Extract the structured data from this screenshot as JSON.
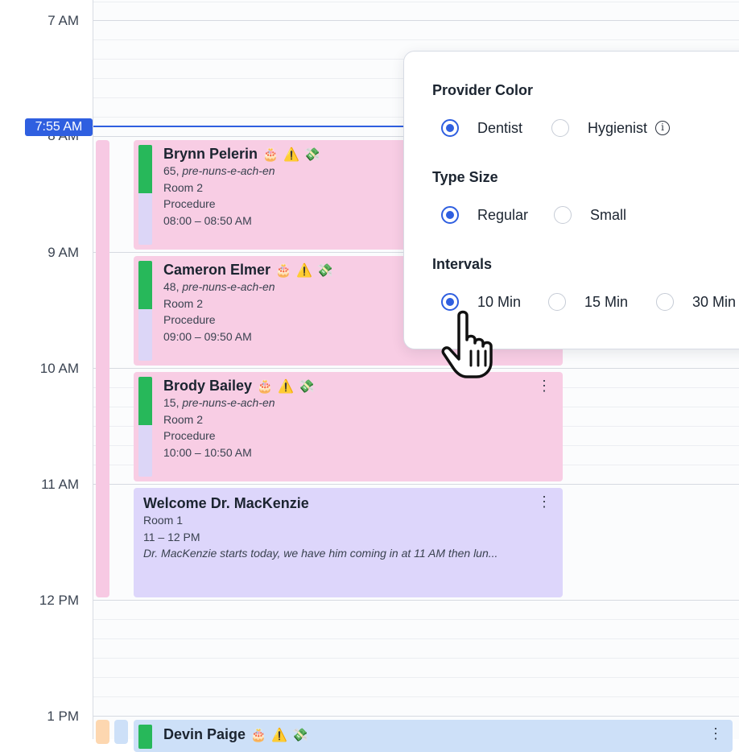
{
  "times": {
    "t7": "7 AM",
    "t8": "8 AM",
    "t9": "9 AM",
    "t10": "10 AM",
    "t11": "11 AM",
    "t12": "12 PM",
    "t13": "1 PM"
  },
  "now_marker": "7:55 AM",
  "appointments": [
    {
      "name": "Brynn Pelerin",
      "age": "65,",
      "pronoun": "pre-nuns-e-ach-en",
      "room": "Room 2",
      "type": "Procedure",
      "time": "08:00 – 08:50 AM"
    },
    {
      "name": "Cameron Elmer",
      "age": "48,",
      "pronoun": "pre-nuns-e-ach-en",
      "room": "Room 2",
      "type": "Procedure",
      "time": "09:00 – 09:50 AM"
    },
    {
      "name": "Brody Bailey",
      "age": "15,",
      "pronoun": "pre-nuns-e-ach-en",
      "room": "Room 2",
      "type": "Procedure",
      "time": "10:00 – 10:50 AM"
    }
  ],
  "event": {
    "title": "Welcome Dr. MacKenzie",
    "room": "Room 1",
    "time": "11 – 12 PM",
    "note": "Dr. MacKenzie starts today, we have him coming in at 11 AM then lun..."
  },
  "bottom_appt": {
    "name": "Devin Paige"
  },
  "icons": {
    "cake": "🎂",
    "warning": "⚠️",
    "money": "💸",
    "kebab": "⋮"
  },
  "popup": {
    "provider_color": {
      "label": "Provider Color",
      "options": [
        "Dentist",
        "Hygienist"
      ],
      "selected": "Dentist",
      "info": "i"
    },
    "type_size": {
      "label": "Type Size",
      "options": [
        "Regular",
        "Small"
      ],
      "selected": "Regular"
    },
    "intervals": {
      "label": "Intervals",
      "options": [
        "10 Min",
        "15 Min",
        "30 Min"
      ],
      "selected": "10 Min"
    }
  },
  "colors": {
    "accent": "#2f5fe0",
    "appointment": "#f8cde4",
    "event": "#ddd6fb",
    "status_green": "#27b85a"
  }
}
